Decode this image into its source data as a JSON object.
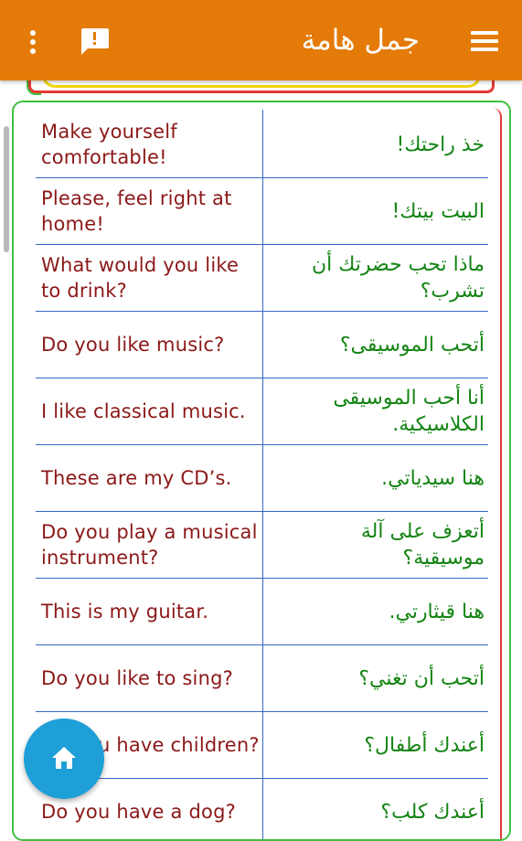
{
  "appbar": {
    "title": "جمل هامة",
    "menu_icon": "hamburger-menu-icon",
    "chat_icon": "feedback-icon",
    "overflow_icon": "more-vert-icon",
    "color": "#e47a07"
  },
  "phrases": [
    {
      "en": "Make yourself comfortable!",
      "ar": "خذ راحتك!"
    },
    {
      "en": "Please, feel right at home!",
      "ar": "البيت بيتك!"
    },
    {
      "en": "What would you like to drink?",
      "ar": "ماذا تحب حضرتك أن تشرب؟"
    },
    {
      "en": "Do you like music?",
      "ar": "أتحب الموسيقى؟"
    },
    {
      "en": "I like classical music.",
      "ar": "أنا أحب الموسيقى الكلاسيكية."
    },
    {
      "en": "These are my CD’s.",
      "ar": "هنا سيدياتي."
    },
    {
      "en": "Do you play a musical instrument?",
      "ar": "أتعزف على آلة موسيقية؟"
    },
    {
      "en": "This is my guitar.",
      "ar": "هنا قيثارتي."
    },
    {
      "en": "Do you like to sing?",
      "ar": "أتحب أن تغني؟"
    },
    {
      "en": "Do you have children?",
      "ar": "أعندك أطفال؟"
    },
    {
      "en": "Do you have a dog?",
      "ar": "أعندك كلب؟"
    }
  ],
  "fab": {
    "icon": "home-icon",
    "color": "#1e9fd7"
  },
  "colors": {
    "english_text": "#8b1818",
    "arabic_text": "#138413",
    "divider": "#3567c8"
  }
}
